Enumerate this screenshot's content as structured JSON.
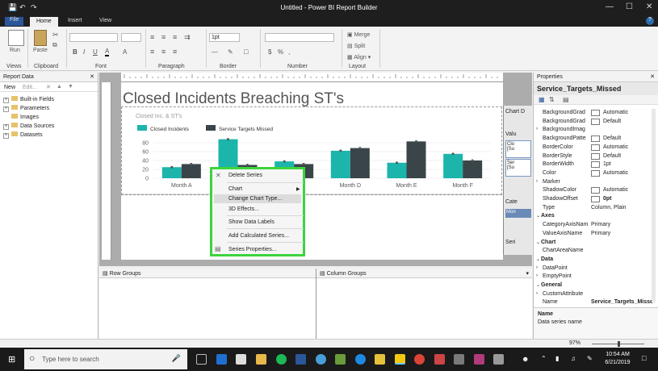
{
  "window": {
    "title": "Untitled - Power BI Report Builder",
    "min": "—",
    "max": "☐",
    "close": "✕",
    "help": "?"
  },
  "menu": {
    "file": "File",
    "home": "Home",
    "insert": "Insert",
    "view": "View"
  },
  "ribbon": {
    "run": "Run",
    "paste": "Paste",
    "groups": {
      "views": "Views",
      "clipboard": "Clipboard",
      "font": "Font",
      "paragraph": "Paragraph",
      "border": "Border",
      "number": "Number",
      "layout": "Layout"
    },
    "border_width": "1pt",
    "merge": "Merge",
    "split": "Split",
    "align": "Align"
  },
  "report_data": {
    "title": "Report Data",
    "new": "New",
    "edit": "Edit...",
    "items": [
      "Built-in Fields",
      "Parameters",
      "Images",
      "Data Sources",
      "Datasets"
    ]
  },
  "report": {
    "title": "Closed Incidents Breaching ST's",
    "subtitle": "Closed Inc. & ST's"
  },
  "chart_data": {
    "type": "bar",
    "categories": [
      "Month A",
      "Month B",
      "Month C",
      "Month D",
      "Month E",
      "Month F"
    ],
    "series": [
      {
        "name": "Closed Incidents",
        "color": "#1cb5ac",
        "values": [
          25,
          88,
          38,
          62,
          35,
          55
        ]
      },
      {
        "name": "Service Targets Missed",
        "color": "#3a4549",
        "values": [
          32,
          30,
          32,
          68,
          83,
          40
        ]
      }
    ],
    "yticks": [
      0,
      20,
      40,
      60,
      80
    ],
    "ylim": [
      0,
      100
    ],
    "legend": "top-left"
  },
  "chart_panel": {
    "title": "Chart D",
    "value": "Valu",
    "item1": "Clo",
    "item1_sub": "[Su",
    "item2": "Ser",
    "item2_sub": "[Su",
    "cat": "Cate",
    "cat_item": "Mon",
    "series": "Seri"
  },
  "row_groups": "Row Groups",
  "column_groups": "Column Groups",
  "context_menu": {
    "delete_series": "Delete Series",
    "chart": "Chart",
    "change_chart_type": "Change Chart Type...",
    "effects": "3D Effects...",
    "show_data_labels": "Show Data Labels",
    "add_calculated_series": "Add Calculated Series...",
    "series_properties": "Series Properties..."
  },
  "properties": {
    "header": "Properties",
    "object": "Service_Targets_Missed",
    "rows": [
      {
        "name": "BackgroundGrad",
        "value": "Automatic",
        "swatch": true
      },
      {
        "name": "BackgroundGrad",
        "value": "Default",
        "swatch": true
      },
      {
        "name": "BackgroundImag",
        "value": "",
        "expand": true
      },
      {
        "name": "BackgroundPatte",
        "value": "Default",
        "swatch": true
      },
      {
        "name": "BorderColor",
        "value": "Automatic",
        "swatch": true
      },
      {
        "name": "BorderStyle",
        "value": "Default",
        "swatch": true
      },
      {
        "name": "BorderWidth",
        "value": "1pt",
        "swatch": true
      },
      {
        "name": "Color",
        "value": "Automatic",
        "swatch": true
      },
      {
        "name": "Marker",
        "value": "",
        "expand": true
      },
      {
        "name": "ShadowColor",
        "value": "Automatic",
        "swatch": true
      },
      {
        "name": "ShadowOffset",
        "value": "0pt",
        "swatch": true
      },
      {
        "name": "Type",
        "value": "Column, Plain"
      },
      {
        "name": "Axes",
        "value": "",
        "cat": true
      },
      {
        "name": "CategoryAxisNam",
        "value": "Primary"
      },
      {
        "name": "ValueAxisName",
        "value": "Primary"
      },
      {
        "name": "Chart",
        "value": "",
        "cat": true
      },
      {
        "name": "ChartAreaName",
        "value": ""
      },
      {
        "name": "Data",
        "value": "",
        "cat": true
      },
      {
        "name": "DataPoint",
        "value": "",
        "expand": true
      },
      {
        "name": "EmptyPoint",
        "value": "",
        "expand": true
      },
      {
        "name": "General",
        "value": "",
        "cat": true
      },
      {
        "name": "CustomAttribute",
        "value": "",
        "expand": true
      },
      {
        "name": "Name",
        "value": "Service_Targets_Misse"
      }
    ],
    "desc_title": "Name",
    "desc_text": "Data series name"
  },
  "status": {
    "zoom": "97%"
  },
  "taskbar": {
    "search_placeholder": "Type here to search",
    "time": "10:54 AM",
    "date": "6/21/2019"
  }
}
